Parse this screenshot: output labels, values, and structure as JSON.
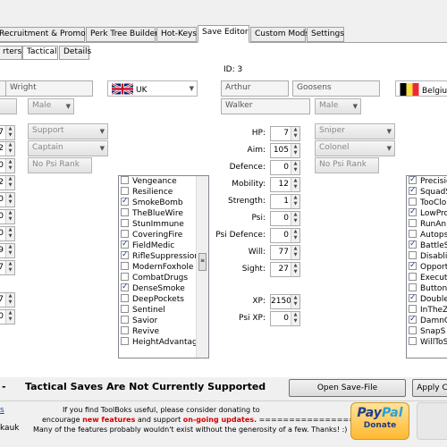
{
  "tabs": [
    "Recruitment & Promotion",
    "Perk Tree Builder",
    "Hot-Keys",
    "Save Editor",
    "Custom Mods",
    "Settings"
  ],
  "subtabs": [
    "rters",
    "Tactical",
    "Details"
  ],
  "left": {
    "last_name": "Wright",
    "country": "UK",
    "gender": "Male",
    "class": "Support",
    "rank": "Captain",
    "psi_rank": "No Psi Rank",
    "stat_fragments": [
      "7",
      "2",
      "0",
      "2",
      "0",
      "0",
      "0",
      "9",
      "7",
      "7",
      "0"
    ],
    "perks": [
      {
        "label": "Vengeance",
        "checked": false
      },
      {
        "label": "Resilience",
        "checked": false
      },
      {
        "label": "SmokeBomb",
        "checked": true
      },
      {
        "label": "TheBlueWire",
        "checked": false
      },
      {
        "label": "StunImmune",
        "checked": false
      },
      {
        "label": "CoveringFire",
        "checked": false
      },
      {
        "label": "FieldMedic",
        "checked": true
      },
      {
        "label": "RifleSuppression",
        "checked": true
      },
      {
        "label": "ModernFoxhole",
        "checked": false
      },
      {
        "label": "CombatDrugs",
        "checked": false
      },
      {
        "label": "DenseSmoke",
        "checked": true
      },
      {
        "label": "DeepPockets",
        "checked": false
      },
      {
        "label": "Sentinel",
        "checked": false
      },
      {
        "label": "Savior",
        "checked": false
      },
      {
        "label": "Revive",
        "checked": false
      },
      {
        "label": "HeightAdvantage",
        "checked": false
      }
    ]
  },
  "right": {
    "id_label": "ID: 3",
    "first_name": "Arthur",
    "last_name": "Goosens",
    "country": "Belgium",
    "nickname": "Walker",
    "gender": "Male",
    "class": "Sniper",
    "rank": "Colonel",
    "psi_rank": "No Psi Rank",
    "stats": [
      {
        "label": "HP:",
        "value": "7"
      },
      {
        "label": "Aim:",
        "value": "105"
      },
      {
        "label": "Defence:",
        "value": "0"
      },
      {
        "label": "Mobility:",
        "value": "12"
      },
      {
        "label": "Strength:",
        "value": "1"
      },
      {
        "label": "Psi:",
        "value": "0"
      },
      {
        "label": "Psi Defence:",
        "value": "0"
      },
      {
        "label": "Will:",
        "value": "77"
      },
      {
        "label": "Sight:",
        "value": "27"
      }
    ],
    "xp_label": "XP:",
    "xp": "2150",
    "psi_xp_label": "Psi XP:",
    "psi_xp": "0",
    "perks": [
      {
        "label": "Precisio",
        "checked": true
      },
      {
        "label": "SquadS",
        "checked": true
      },
      {
        "label": "TooClo",
        "checked": false
      },
      {
        "label": "LowPro",
        "checked": true
      },
      {
        "label": "RunAn",
        "checked": false
      },
      {
        "label": "Autops",
        "checked": false
      },
      {
        "label": "BattleS",
        "checked": true
      },
      {
        "label": "Disabli",
        "checked": false
      },
      {
        "label": "Opport",
        "checked": true
      },
      {
        "label": "Execut",
        "checked": false
      },
      {
        "label": "ButtonU",
        "checked": false
      },
      {
        "label": "Double",
        "checked": true
      },
      {
        "label": "InTheZ",
        "checked": false
      },
      {
        "label": "DamnG",
        "checked": true
      },
      {
        "label": "SnapS",
        "checked": false
      },
      {
        "label": "WillToS",
        "checked": false
      }
    ]
  },
  "status": {
    "prefix": "-",
    "message": "Tactical Saves Are Not Currently Supported",
    "open_button": "Open Save-File",
    "apply_button": "Apply C"
  },
  "footer": {
    "left_fragment_1": "s",
    "left_fragment_2": "kauk",
    "line1": "If you find ToolBoks useful, please consider donating to",
    "line2_pre": "encourage",
    "line2_new": "new features",
    "line2_mid": "and support",
    "line2_updates": "on-going updates.",
    "line2_arrows": "===================>",
    "line3": "Many of the features probably wouldn't exist without the generosity of a few. Thanks! :)",
    "paypal_pay": "Pay",
    "paypal_pal": "Pal",
    "paypal_donate": "Donate"
  },
  "colors": {
    "highlight_red": "#d40000",
    "paypal_blue": "#1f3c88",
    "paypal_light": "#2b9fd9",
    "paypal_orange": "#ffb830"
  }
}
